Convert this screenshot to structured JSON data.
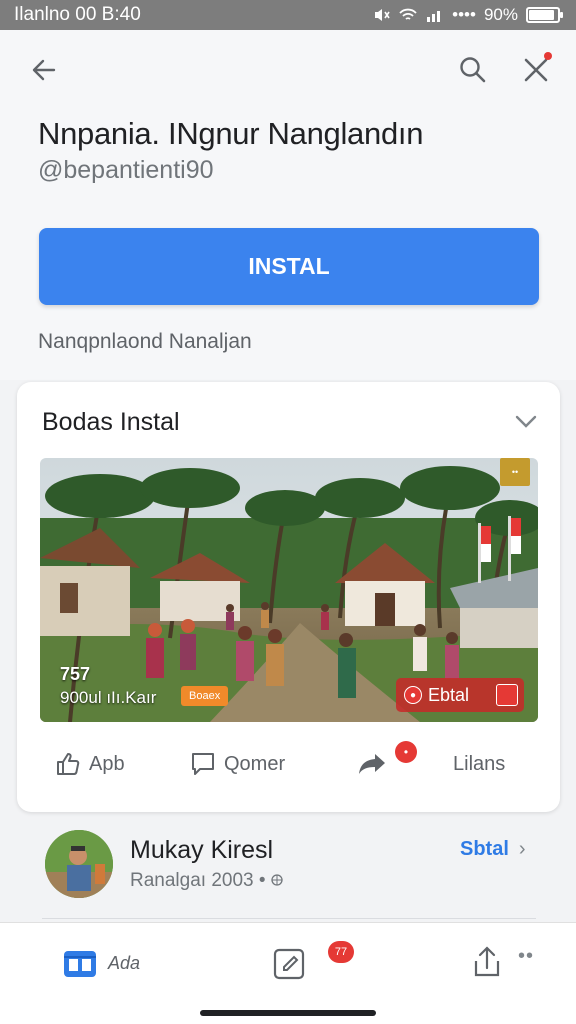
{
  "status_bar": {
    "time": "Ilanlno 00 B:40",
    "signal_text": "••••",
    "battery": "90%",
    "battery_level": 0.9
  },
  "topbar": {
    "back_icon": "arrow-left-icon",
    "search_icon": "search-icon",
    "close_icon": "close-icon"
  },
  "app": {
    "title": "Nnpania. INgnur Nanglandın",
    "handle": "@bepantienti90",
    "install_label": "INSTAL",
    "subtitle": "Nanqpnlaond Nanaljan"
  },
  "card": {
    "title": "Bodas Instal",
    "media": {
      "count": "757",
      "caption": "900ul ıIı.Kaır",
      "tag": "Boaex",
      "action_label": "Ebtal",
      "badge": "••"
    },
    "actions": {
      "like": "Apb",
      "comment": "Qomer",
      "share_badge": "•",
      "listen": "Lilans"
    }
  },
  "author": {
    "name": "Mukay Kiresl",
    "sub": "Ranalgaı 2003",
    "sub_suffix": "•",
    "link": "Sbtal"
  },
  "bottom_nav": {
    "home_label": "Ada",
    "badge": "77",
    "more": "••"
  },
  "colors": {
    "accent": "#3b83ee",
    "badge": "#e53935",
    "link": "#2f7be5"
  }
}
